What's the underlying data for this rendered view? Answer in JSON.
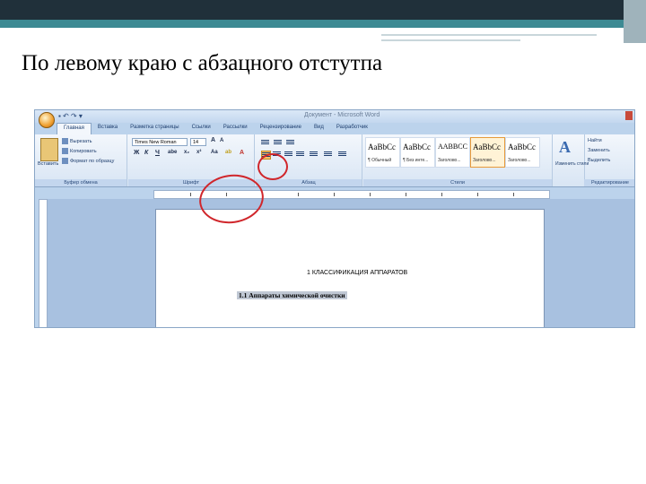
{
  "slide": {
    "title": "По левому краю с абзацного отстутпа"
  },
  "word": {
    "quick_access": "▪ ↶ ↷ ▾",
    "window_title": "Документ - Microsoft Word",
    "tabs": [
      "Главная",
      "Вставка",
      "Разметка страницы",
      "Ссылки",
      "Рассылки",
      "Рецензирование",
      "Вид",
      "Разработчик"
    ],
    "clipboard": {
      "paste": "Вставить",
      "cut": "Вырезать",
      "copy": "Копировать",
      "format_painter": "Формат по образцу",
      "label": "Буфер обмена"
    },
    "font": {
      "name": "Times New Roman",
      "size": "14",
      "grow": "A",
      "shrink": "A",
      "label": "Шрифт"
    },
    "paragraph": {
      "label": "Абзац"
    },
    "styles": {
      "label": "Стили",
      "items": [
        {
          "sample": "AaBbCc",
          "name": "¶ Обычный"
        },
        {
          "sample": "AaBbCc",
          "name": "¶ Без инте..."
        },
        {
          "sample": "AABBCC",
          "name": "Заголово..."
        },
        {
          "sample": "AaBbCc",
          "name": "Заголово..."
        },
        {
          "sample": "AaBbCc",
          "name": "Заголово..."
        },
        {
          "sample": "AaBbCc",
          "name": "Заголово..."
        }
      ],
      "change_styles": "Изменить стили"
    },
    "editing": {
      "find": "Найти",
      "replace": "Заменить",
      "select": "Выделить",
      "label": "Редактирование"
    },
    "document": {
      "heading": "1 КЛАССИФИКАЦИЯ АППАРАТОВ",
      "subheading": "1.1 Аппараты химической очистки"
    }
  },
  "colors": {
    "annotation": "#d0262b",
    "ribbon": "#dbe8f7",
    "slide_teal": "#3d8a93"
  }
}
